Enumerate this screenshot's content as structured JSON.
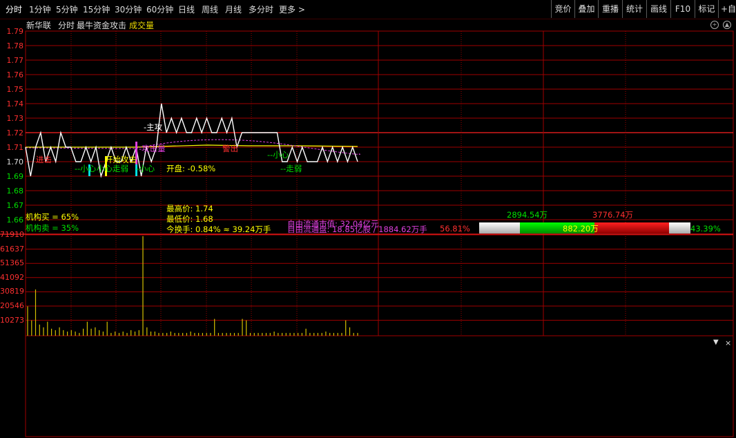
{
  "toolbar": {
    "tabs": [
      "分时",
      "1分钟",
      "5分钟",
      "15分钟",
      "30分钟",
      "60分钟",
      "日线",
      "周线",
      "月线",
      "多分时",
      "更多 >"
    ],
    "right_buttons": [
      "竞价",
      "叠加",
      "重播",
      "统计",
      "画线",
      "F10",
      "标记",
      "+自选"
    ]
  },
  "header": {
    "stock_name": "新华联",
    "mode": "分时",
    "indicator": "最牛资金攻击",
    "volume_label": "成交量",
    "settings_icon": "settings-icon",
    "scroll_icon": "scroll-icon"
  },
  "price_axis": [
    "1.79",
    "1.78",
    "1.77",
    "1.76",
    "1.75",
    "1.74",
    "1.73",
    "1.72",
    "1.71",
    "1.70",
    "1.69",
    "1.68",
    "1.67",
    "1.66"
  ],
  "volume_axis": [
    "71910",
    "61637",
    "51365",
    "41092",
    "30819",
    "20546",
    "10273"
  ],
  "chart_labels": {
    "main_attack": "-主攻",
    "attack_volume": "-攻击量",
    "sell": "警出",
    "enter": "进击",
    "caution_1": "--小心",
    "caution_2": "-小心",
    "caution_3": "--小心",
    "weak": "--走弱",
    "start_attack": "开始攻击",
    "caution_weak": "小心走弱",
    "open": "开盘: -0.58%"
  },
  "stats": {
    "inst_buy": "机构买 = 65%",
    "inst_sell": "机构卖 = 35%",
    "high": "最高价: 1.74",
    "low": "最低价: 1.68",
    "turnover": "今换手: 0.84% ≈ 39.24万手",
    "float_value": "自由流通市值: 32.04亿元",
    "float_shares": "自由流通盘: 18.85亿股 / 1884.62万手",
    "float_pct": "56.81%",
    "buy_vol": "2894.54万",
    "sell_vol": "3776.74万",
    "mid_vol": "882.20万",
    "right_pct": "43.39%"
  },
  "colors": {
    "up": "#ff3030",
    "down": "#00e000",
    "grid": "#a00000",
    "volume_bar": "#d4c000",
    "price_line": "#ffffff",
    "avg_line": "#ffff00",
    "magenta": "#e040e0"
  },
  "chart_data": {
    "type": "line",
    "title": "新华联 分时",
    "ylim": [
      1.66,
      1.79
    ],
    "series": [
      {
        "name": "price",
        "values": [
          1.71,
          1.69,
          1.71,
          1.72,
          1.7,
          1.71,
          1.7,
          1.72,
          1.71,
          1.71,
          1.7,
          1.7,
          1.71,
          1.7,
          1.71,
          1.69,
          1.7,
          1.71,
          1.7,
          1.7,
          1.71,
          1.7,
          1.71,
          1.69,
          1.71,
          1.7,
          1.71,
          1.74,
          1.72,
          1.73,
          1.72,
          1.73,
          1.72,
          1.72,
          1.73,
          1.72,
          1.73,
          1.72,
          1.72,
          1.73,
          1.72,
          1.73,
          1.71,
          1.72,
          1.72,
          1.72,
          1.72,
          1.72,
          1.72,
          1.72,
          1.72,
          1.7,
          1.7,
          1.71,
          1.7,
          1.71,
          1.7,
          1.7,
          1.7,
          1.71,
          1.7,
          1.71,
          1.7,
          1.71,
          1.7,
          1.71,
          1.7
        ]
      }
    ],
    "volume": [
      21000,
      11000,
      33000,
      8000,
      6000,
      10000,
      5000,
      4000,
      6000,
      4000,
      3000,
      4000,
      3000,
      2000,
      5000,
      10000,
      5000,
      6000,
      4000,
      3000,
      10000,
      2000,
      3000,
      2000,
      3000,
      2000,
      4000,
      3000,
      4000,
      71000,
      6000,
      3000,
      3000,
      2000,
      2000,
      2000,
      3000,
      2000,
      2000,
      2000,
      2000,
      3000,
      2000,
      2000,
      2000,
      2000,
      2000,
      12000,
      2000,
      2000,
      2000,
      2000,
      2000,
      2000,
      12000,
      11000,
      2000,
      2000,
      2000,
      2000,
      2000,
      2000,
      3000,
      2000,
      2000,
      2000,
      2000,
      2000,
      2000,
      2000,
      5000,
      2000,
      2000,
      2000,
      2000,
      3000,
      2000,
      2000,
      2000,
      2000,
      11000,
      6000,
      2000,
      2000
    ]
  }
}
